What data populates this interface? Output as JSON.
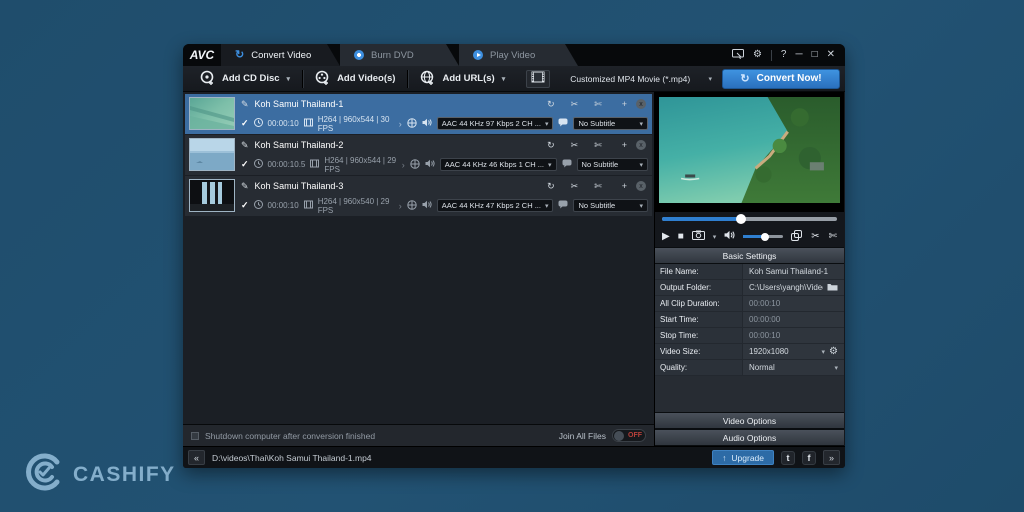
{
  "brand": {
    "name": "CASHIFY"
  },
  "colors": {
    "accent_blue": "#2f7fd0",
    "selected_row": "#3c6da1",
    "toggle_off": "#b6403a",
    "background": "#225273"
  },
  "icons": {
    "caret": "▾",
    "plus": "+",
    "close_small": "x",
    "check": "✓",
    "pencil": "✎",
    "refresh": "↻",
    "scissors": "✂",
    "scissors_alt": "✄",
    "play": "▶",
    "stop": "■",
    "chevron": "›",
    "help": "?",
    "minimize": "─",
    "maximize": "□",
    "close": "✕",
    "back": "«",
    "forward": "»",
    "up_arrow": "↑",
    "twitter": "t",
    "facebook": "f",
    "gear": "⚙"
  },
  "window": {
    "logo": "AVC",
    "tabs": [
      {
        "label": "Convert Video",
        "active": true
      },
      {
        "label": "Burn DVD",
        "active": false
      },
      {
        "label": "Play Video",
        "active": false
      }
    ],
    "toolbar": {
      "add_cd_label": "Add CD Disc",
      "add_videos_label": "Add Video(s)",
      "add_urls_label": "Add URL(s)",
      "profile_value": "Customized MP4 Movie (*.mp4)",
      "convert_label": "Convert Now!"
    },
    "list": {
      "items": [
        {
          "title": "Koh Samui Thailand-1",
          "duration": "00:00:10",
          "video_info": "H264 | 960x544 | 30 FPS",
          "audio": "AAC 44 KHz 97 Kbps 2 CH ...",
          "subtitle": "No Subtitle",
          "selected": true
        },
        {
          "title": "Koh Samui Thailand-2",
          "duration": "00:00:10.5",
          "video_info": "H264 | 960x544 | 29 FPS",
          "audio": "AAC 44 KHz 46 Kbps 1 CH ...",
          "subtitle": "No Subtitle",
          "selected": false
        },
        {
          "title": "Koh Samui Thailand-3",
          "duration": "00:00:10",
          "video_info": "H264 | 960x540 | 29 FPS",
          "audio": "AAC 44 KHz 47 Kbps 2 CH ...",
          "subtitle": "No Subtitle",
          "selected": false
        }
      ],
      "footer": {
        "shutdown_label": "Shutdown computer after conversion finished",
        "join_label": "Join All Files",
        "join_state": "OFF"
      }
    },
    "settings": {
      "title": "Basic Settings",
      "rows": [
        {
          "label": "File Name:",
          "value": "Koh Samui Thailand-1"
        },
        {
          "label": "Output Folder:",
          "value": "C:\\Users\\yangh\\Videos..."
        },
        {
          "label": "All Clip Duration:",
          "value": "00:00:10"
        },
        {
          "label": "Start Time:",
          "value": "00:00:00"
        },
        {
          "label": "Stop Time:",
          "value": "00:00:10"
        },
        {
          "label": "Video Size:",
          "value": "1920x1080"
        },
        {
          "label": "Quality:",
          "value": "Normal"
        }
      ],
      "video_options_label": "Video Options",
      "audio_options_label": "Audio Options"
    },
    "statusbar": {
      "path": "D:\\videos\\Thai\\Koh Samui Thailand-1.mp4",
      "upgrade_label": "Upgrade"
    }
  }
}
